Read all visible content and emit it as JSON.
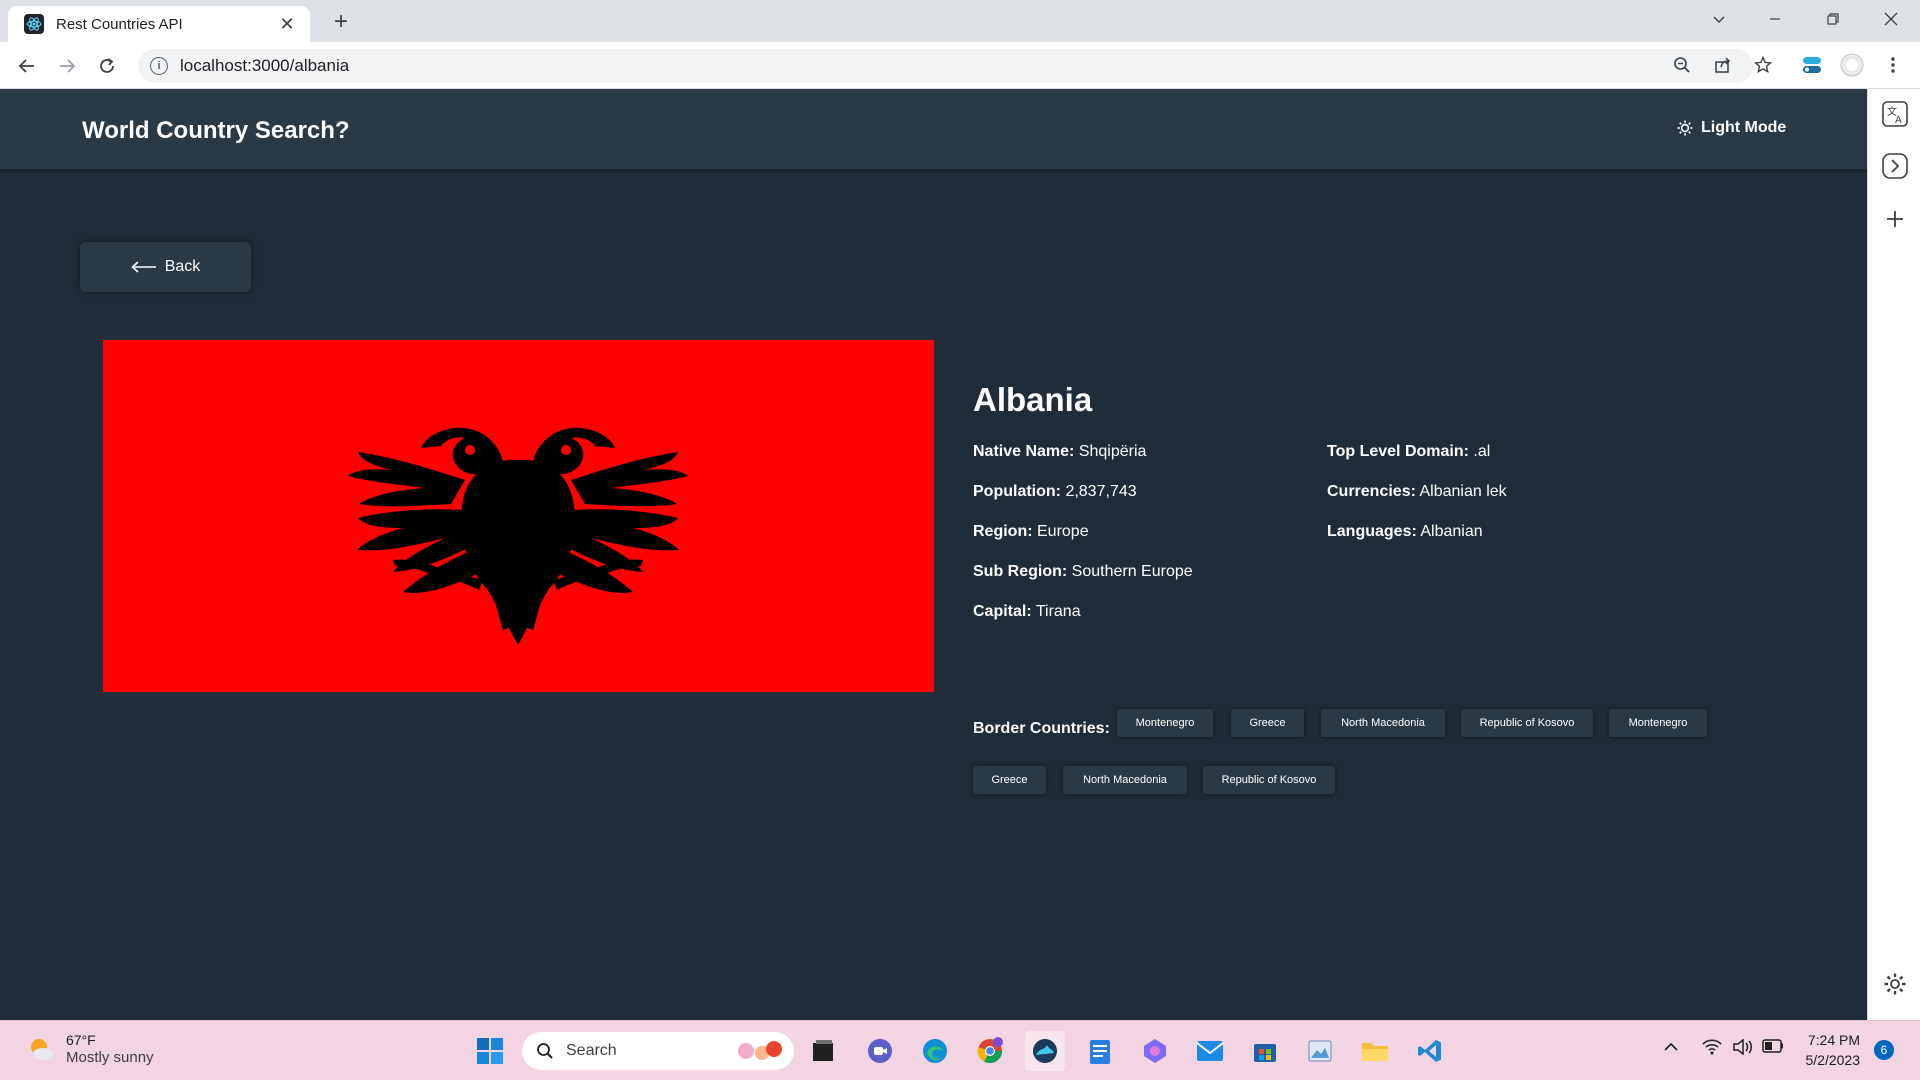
{
  "browser": {
    "tab_title": "Rest Countries API",
    "url": "localhost:3000/albania",
    "new_tab_label": "+"
  },
  "app": {
    "title": "World Country Search?",
    "mode_label": "Light Mode",
    "back_label": "Back"
  },
  "country": {
    "name": "Albania",
    "left_fields": [
      {
        "label": "Native Name:",
        "value": "Shqipëria"
      },
      {
        "label": "Population:",
        "value": "2,837,743"
      },
      {
        "label": "Region:",
        "value": "Europe"
      },
      {
        "label": "Sub Region:",
        "value": "Southern Europe"
      },
      {
        "label": "Capital:",
        "value": "Tirana"
      }
    ],
    "right_fields": [
      {
        "label": "Top Level Domain:",
        "value": ".al"
      },
      {
        "label": "Currencies:",
        "value": "Albanian lek"
      },
      {
        "label": "Languages:",
        "value": "Albanian"
      }
    ],
    "border_label": "Border Countries:",
    "border_countries": [
      "Montenegro",
      "Greece",
      "North Macedonia",
      "Republic of Kosovo",
      "Montenegro",
      "Greece",
      "North Macedonia",
      "Republic of Kosovo"
    ],
    "flag_colors": {
      "field": "#ff0000",
      "eagle": "#000000"
    }
  },
  "taskbar": {
    "weather_temp": "67°F",
    "weather_desc": "Mostly sunny",
    "search_label": "Search",
    "time": "7:24 PM",
    "date": "5/2/2023",
    "notification_count": "6",
    "apps": [
      "start-icon",
      "file-viewer-icon",
      "meet-icon",
      "edge-icon",
      "chrome-icon",
      "app-icon",
      "notepad-icon",
      "copilot-icon",
      "mail-icon",
      "store-icon",
      "paint-icon",
      "file-explorer-icon",
      "vscode-icon"
    ]
  },
  "colors": {
    "app_bg": "#202c37",
    "element_bg": "#2b3945",
    "text": "#ffffff"
  }
}
